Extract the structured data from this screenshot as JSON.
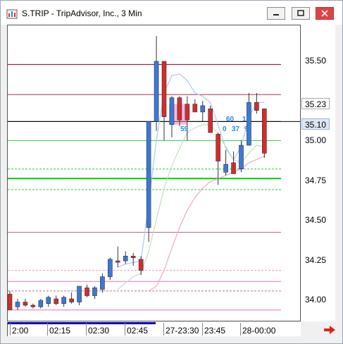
{
  "window": {
    "title": "S.TRIP - TripAdvisor, Inc., 3 Min",
    "minimize_icon": "minimize-icon",
    "maximize_icon": "maximize-icon",
    "close_icon": "close-icon"
  },
  "axes": {
    "y_ticks": [
      "35.50",
      "35.25",
      "35.00",
      "34.75",
      "34.50",
      "34.25",
      "34.00"
    ],
    "x_ticks": [
      "2:00",
      "02:15",
      "02:30",
      "02:45",
      "27-23:30",
      "23:45",
      "28-00:00"
    ],
    "price_tags": [
      {
        "label": "35.23",
        "bg": "#ffffff",
        "fg": "#000000"
      },
      {
        "label": "35.10",
        "bg": "#dde6f5",
        "fg": "#000000"
      }
    ]
  },
  "annotations": {
    "label_a": "60",
    "label_b": "13",
    "label_c": "0",
    "label_d": "37",
    "label_e": "%",
    "label_f": "59"
  },
  "colors": {
    "up": "#3a79d8",
    "down": "#d52b2b",
    "accent_green": "#2ecc40",
    "pink": "#f2a6c8",
    "maroon": "#8b2a4a"
  },
  "chart_data": {
    "type": "candlestick",
    "title": "",
    "ylim": [
      33.9,
      35.65
    ],
    "candles": [
      {
        "o": 34.03,
        "h": 34.05,
        "l": 33.93,
        "c": 33.93,
        "dir": "down"
      },
      {
        "o": 33.95,
        "h": 34.0,
        "l": 33.93,
        "c": 33.98,
        "dir": "up"
      },
      {
        "o": 33.98,
        "h": 34.0,
        "l": 33.95,
        "c": 33.96,
        "dir": "down"
      },
      {
        "o": 33.96,
        "h": 33.97,
        "l": 33.94,
        "c": 33.95,
        "dir": "down"
      },
      {
        "o": 33.95,
        "h": 34.0,
        "l": 33.94,
        "c": 33.99,
        "dir": "up"
      },
      {
        "o": 33.97,
        "h": 34.02,
        "l": 33.95,
        "c": 34.01,
        "dir": "up"
      },
      {
        "o": 34.0,
        "h": 34.02,
        "l": 33.96,
        "c": 33.97,
        "dir": "down"
      },
      {
        "o": 33.97,
        "h": 34.02,
        "l": 33.95,
        "c": 34.01,
        "dir": "up"
      },
      {
        "o": 34.0,
        "h": 34.04,
        "l": 33.97,
        "c": 33.98,
        "dir": "down"
      },
      {
        "o": 33.98,
        "h": 34.08,
        "l": 33.96,
        "c": 34.08,
        "dir": "up"
      },
      {
        "o": 34.07,
        "h": 34.09,
        "l": 34.01,
        "c": 34.02,
        "dir": "down"
      },
      {
        "o": 34.02,
        "h": 34.08,
        "l": 34.0,
        "c": 34.07,
        "dir": "up"
      },
      {
        "o": 34.06,
        "h": 34.16,
        "l": 34.04,
        "c": 34.14,
        "dir": "up"
      },
      {
        "o": 34.14,
        "h": 34.26,
        "l": 34.12,
        "c": 34.25,
        "dir": "up"
      },
      {
        "o": 34.24,
        "h": 34.33,
        "l": 34.2,
        "c": 34.24,
        "dir": "down"
      },
      {
        "o": 34.24,
        "h": 34.3,
        "l": 34.22,
        "c": 34.27,
        "dir": "up"
      },
      {
        "o": 34.27,
        "h": 34.29,
        "l": 34.21,
        "c": 34.26,
        "dir": "down"
      },
      {
        "o": 34.25,
        "h": 34.27,
        "l": 34.15,
        "c": 34.18,
        "dir": "down"
      },
      {
        "o": 34.45,
        "h": 35.1,
        "l": 34.36,
        "c": 35.12,
        "dir": "up"
      },
      {
        "o": 35.12,
        "h": 35.66,
        "l": 35.06,
        "c": 35.5,
        "dir": "up"
      },
      {
        "o": 35.5,
        "h": 35.5,
        "l": 35.0,
        "c": 35.15,
        "dir": "down"
      },
      {
        "o": 35.1,
        "h": 35.28,
        "l": 35.02,
        "c": 35.27,
        "dir": "up"
      },
      {
        "o": 35.27,
        "h": 35.28,
        "l": 35.09,
        "c": 35.13,
        "dir": "down"
      },
      {
        "o": 35.13,
        "h": 35.28,
        "l": 35.0,
        "c": 35.23,
        "dir": "down"
      },
      {
        "o": 35.23,
        "h": 35.26,
        "l": 35.18,
        "c": 35.18,
        "dir": "down"
      },
      {
        "o": 35.18,
        "h": 35.25,
        "l": 35.12,
        "c": 35.22,
        "dir": "up"
      },
      {
        "o": 35.2,
        "h": 35.22,
        "l": 35.05,
        "c": 35.05,
        "dir": "down"
      },
      {
        "o": 35.04,
        "h": 35.05,
        "l": 34.72,
        "c": 34.87,
        "dir": "down"
      },
      {
        "o": 34.8,
        "h": 34.94,
        "l": 34.78,
        "c": 34.85,
        "dir": "up"
      },
      {
        "o": 34.86,
        "h": 34.93,
        "l": 34.79,
        "c": 34.79,
        "dir": "down"
      },
      {
        "o": 34.82,
        "h": 35.0,
        "l": 34.8,
        "c": 34.97,
        "dir": "up"
      },
      {
        "o": 34.97,
        "h": 35.3,
        "l": 34.97,
        "c": 35.24,
        "dir": "up"
      },
      {
        "o": 35.24,
        "h": 35.3,
        "l": 35.17,
        "c": 35.19,
        "dir": "down"
      },
      {
        "o": 35.2,
        "h": 35.2,
        "l": 34.89,
        "c": 34.92,
        "dir": "down"
      }
    ],
    "h_levels": [
      {
        "y": 35.48,
        "color": "#8b2a4a",
        "width": 1.2
      },
      {
        "y": 35.29,
        "color": "#a0304a",
        "width": 1
      },
      {
        "y": 35.12,
        "color": "#000000",
        "width": 1
      },
      {
        "y": 35.0,
        "color": "#2ecc40",
        "width": 1
      },
      {
        "y": 34.82,
        "color": "#2ecc40",
        "width": 1,
        "dash": true
      },
      {
        "y": 34.76,
        "color": "#00cc00",
        "width": 2
      },
      {
        "y": 34.69,
        "color": "#2ecc40",
        "width": 1,
        "dash": true
      },
      {
        "y": 34.42,
        "color": "#9b3b6b",
        "width": 0.8
      },
      {
        "y": 34.18,
        "color": "#e8a0c8",
        "width": 1,
        "dash": true
      },
      {
        "y": 34.11,
        "color": "#e870c0",
        "width": 1
      },
      {
        "y": 34.05,
        "color": "#c070a0",
        "width": 1,
        "dash": true
      },
      {
        "y": 33.93,
        "color": "#e870c0",
        "width": 1
      }
    ],
    "bands": {
      "upper": [
        null,
        null,
        null,
        null,
        null,
        null,
        null,
        null,
        null,
        null,
        null,
        null,
        null,
        null,
        34.2,
        34.22,
        34.23,
        34.24,
        34.6,
        35.0,
        35.3,
        35.41,
        35.42,
        35.38,
        35.3,
        35.28,
        35.24,
        35.1,
        34.95,
        34.88,
        34.96,
        35.15,
        35.24,
        35.24
      ],
      "mid": [
        null,
        null,
        null,
        null,
        null,
        null,
        null,
        null,
        null,
        null,
        null,
        null,
        null,
        null,
        34.06,
        34.1,
        34.14,
        34.16,
        34.3,
        34.5,
        34.7,
        34.84,
        34.95,
        35.05,
        35.08,
        35.1,
        35.1,
        35.04,
        34.96,
        34.88,
        34.86,
        34.92,
        34.97,
        34.96
      ],
      "lower": [
        null,
        null,
        null,
        null,
        null,
        null,
        null,
        null,
        null,
        null,
        null,
        null,
        null,
        null,
        null,
        null,
        null,
        null,
        34.05,
        34.08,
        34.18,
        34.32,
        34.45,
        34.56,
        34.64,
        34.7,
        34.74,
        34.76,
        34.78,
        34.8,
        34.82,
        34.86,
        34.88,
        34.9
      ]
    }
  }
}
